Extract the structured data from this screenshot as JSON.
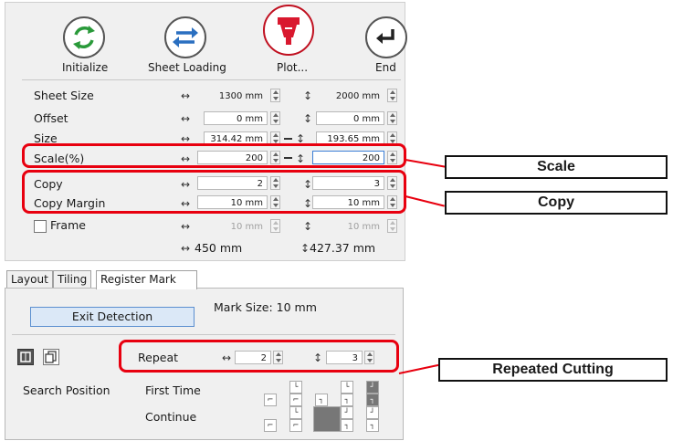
{
  "toolbar": {
    "initialize": "Initialize",
    "sheet_loading": "Sheet Loading",
    "plot": "Plot...",
    "end": "End"
  },
  "settings": {
    "sheet_size": {
      "label": "Sheet Size",
      "x": "1300 mm",
      "y": "2000 mm"
    },
    "offset": {
      "label": "Offset",
      "x": "0 mm",
      "y": "0 mm"
    },
    "size": {
      "label": "Size",
      "x": "314.42 mm",
      "y": "193.65 mm"
    },
    "scale": {
      "label": "Scale(%)",
      "x": "200",
      "y": "200"
    },
    "copy": {
      "label": "Copy",
      "x": "2",
      "y": "3"
    },
    "copy_margin": {
      "label": "Copy Margin",
      "x": "10 mm",
      "y": "10 mm"
    },
    "frame": {
      "label": "Frame",
      "x": "10 mm",
      "y": "10 mm"
    },
    "total_x": "450 mm",
    "total_y": "427.37 mm",
    "arrow_h": "↔",
    "arrow_v": "↕"
  },
  "tabs": [
    "Layout",
    "Tiling",
    "Register Mark"
  ],
  "register": {
    "exit_detection": "Exit Detection",
    "mark_size": "Mark Size:  10 mm",
    "repeat": "Repeat",
    "repeat_x": "2",
    "repeat_y": "3",
    "search_position": "Search Position",
    "first_time": "First Time",
    "continue": "Continue"
  },
  "callouts": {
    "scale": "Scale",
    "copy": "Copy",
    "repeated_cutting": "Repeated Cutting"
  },
  "colors": {
    "highlight": "#e8000f",
    "accent_red": "#d9182e",
    "accent_green": "#2a9a3a",
    "accent_blue": "#2a6fc0"
  }
}
